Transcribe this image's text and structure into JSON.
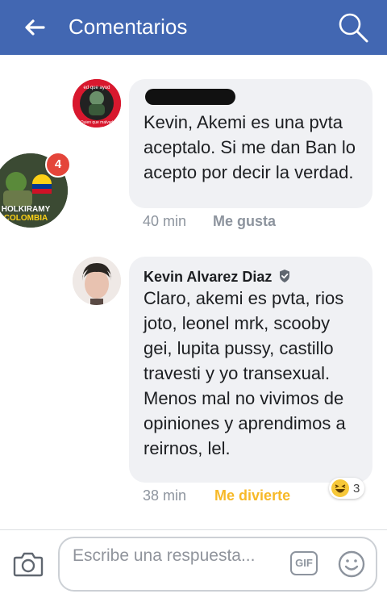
{
  "header": {
    "title": "Comentarios",
    "back_icon": "arrow-left-icon",
    "search_icon": "search-icon",
    "color": "#4267b2"
  },
  "comments": [
    {
      "author": "",
      "author_redacted": true,
      "avatar_text_top": "ed que ayud",
      "avatar_text_bottom": "Quien que malvad",
      "text": "Kevin, Akemi es una pvta aceptalo. Si me dan Ban lo acepto por decir la verdad.",
      "time": "40 min",
      "action": "Me gusta"
    },
    {
      "author": "Kevin Alvarez Diaz",
      "verified": true,
      "text": "Claro, akemi es pvta, rios joto, leonel mrk, scooby gei, lupita pussy, castillo travesti y yo transexual. Menos mal no vivimos de opiniones y aprendimos a reirnos, lel.",
      "time": "38 min",
      "action": "Me divierte",
      "reaction": {
        "icon": "laughing-emoji-icon",
        "count": "3"
      }
    }
  ],
  "chat_head": {
    "label_top": "HOLKIRAMY",
    "label_bottom": "COLOMBIA",
    "badge_count": "4"
  },
  "composer": {
    "placeholder": "Escribe una respuesta...",
    "gif_label": "GIF",
    "camera_icon": "camera-icon",
    "emoji_icon": "smiley-icon"
  }
}
